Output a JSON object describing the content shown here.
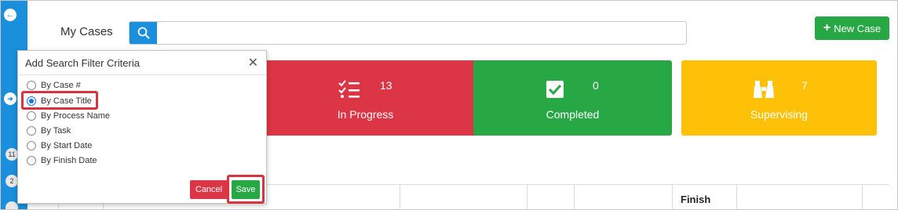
{
  "header": {
    "title": "My Cases",
    "search_placeholder": "",
    "new_case_label": "New Case"
  },
  "cards": [
    {
      "label": "In Progress",
      "count": "13",
      "color": "#dc3545",
      "icon": "checklist-icon"
    },
    {
      "label": "Completed",
      "count": "0",
      "color": "#28a745",
      "icon": "checkbox-icon"
    },
    {
      "label": "Supervising",
      "count": "7",
      "color": "#ffc107",
      "icon": "binoculars-icon"
    }
  ],
  "rail": {
    "badges": [
      "11",
      "2"
    ]
  },
  "table": {
    "visible_header": "Finish"
  },
  "dialog": {
    "title": "Add Search Filter Criteria",
    "options": [
      {
        "label": "By Case #",
        "selected": false
      },
      {
        "label": "By Case Title",
        "selected": true
      },
      {
        "label": "By Process Name",
        "selected": false
      },
      {
        "label": "By Task",
        "selected": false
      },
      {
        "label": "By Start Date",
        "selected": false
      },
      {
        "label": "By Finish Date",
        "selected": false
      }
    ],
    "cancel_label": "Cancel",
    "save_label": "Save"
  },
  "colors": {
    "accent_blue": "#1a8fdc",
    "highlight_red": "#d9333f"
  }
}
